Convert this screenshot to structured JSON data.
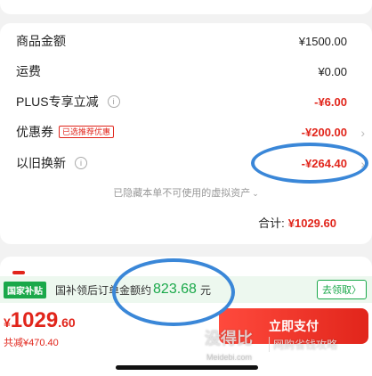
{
  "summary": {
    "rows": [
      {
        "label": "商品金额",
        "value": "¥1500.00"
      },
      {
        "label": "运费",
        "value": "¥0.00"
      },
      {
        "label": "PLUS专享立减",
        "value": "-¥6.00"
      },
      {
        "label": "优惠券",
        "tag": "已选推荐优惠",
        "value": "-¥200.00"
      },
      {
        "label": "以旧换新",
        "value": "-¥264.40"
      }
    ],
    "info_icon": "i",
    "arrow": "›",
    "hidden_note": "已隐藏本单不可使用的虚拟资产",
    "hidden_note_chevron": "⌄",
    "total_label": "合计:",
    "total_value": "¥1029.60"
  },
  "subsidy": {
    "badge": "国家补贴",
    "text": "国补领后订单金额约",
    "amount": "823.68",
    "unit": "元",
    "button": "去领取〉"
  },
  "footer": {
    "currency": "¥",
    "price_int": "1029",
    "price_dec": ".60",
    "saved": "共减¥470.40",
    "pay_button": "立即支付"
  },
  "watermark": {
    "logo": "没得比",
    "sub": "网购省钱攻略",
    "url": "Meidebi.com"
  },
  "colors": {
    "accent_red": "#e1251b",
    "subsidy_green": "#1aa84a",
    "annotation_blue": "#3a87d8"
  }
}
